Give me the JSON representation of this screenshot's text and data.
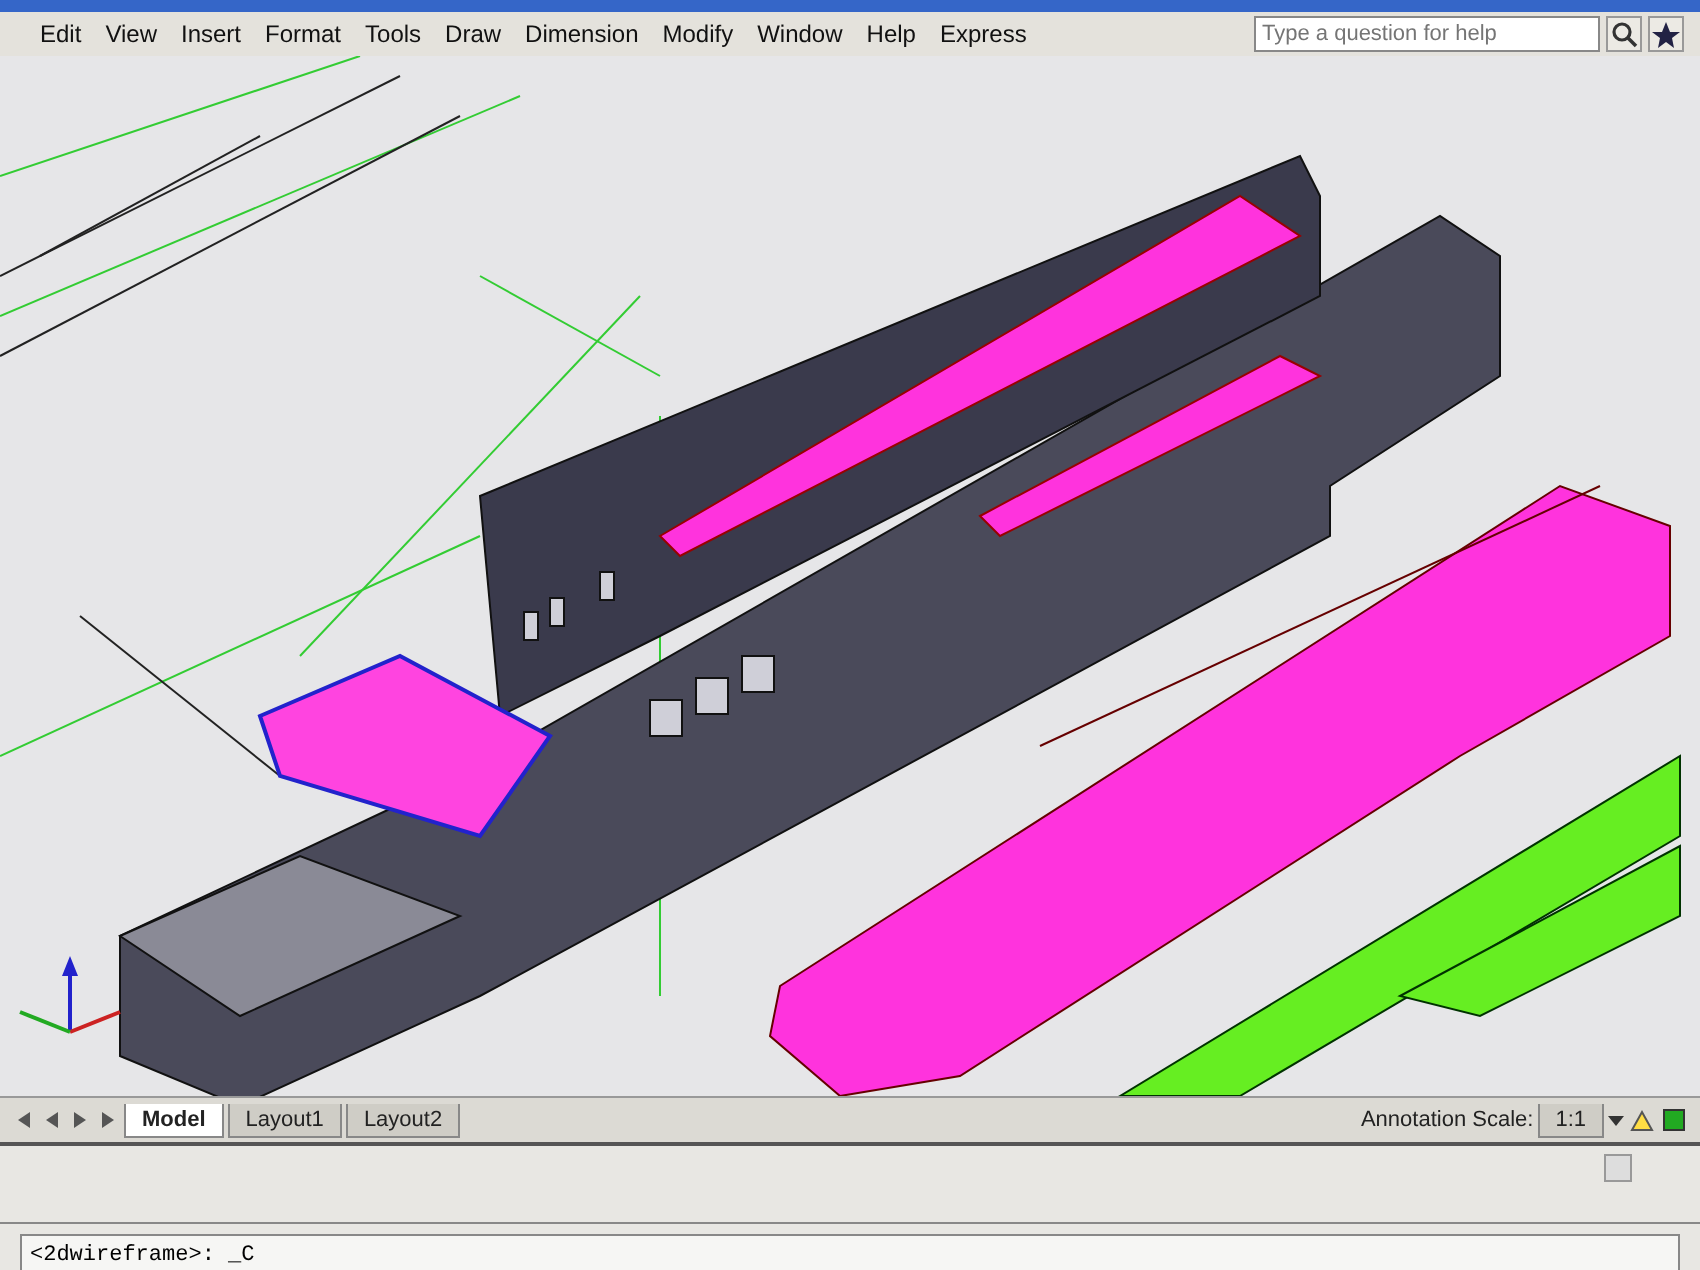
{
  "menu_bar": {
    "items": [
      "Edit",
      "View",
      "Insert",
      "Format",
      "Tools",
      "Draw",
      "Dimension",
      "Modify",
      "Window",
      "Help",
      "Express"
    ]
  },
  "help_search": {
    "placeholder": "Type a question for help"
  },
  "layout_tabs": [
    {
      "label": "Model",
      "selected": true
    },
    {
      "label": "Layout1",
      "selected": false
    },
    {
      "label": "Layout2",
      "selected": false
    }
  ],
  "status": {
    "annotation_scale_label": "Annotation Scale:",
    "annotation_scale_value": "1:1"
  },
  "command_line": {
    "prompt": "<2dwireframe>: _C"
  }
}
